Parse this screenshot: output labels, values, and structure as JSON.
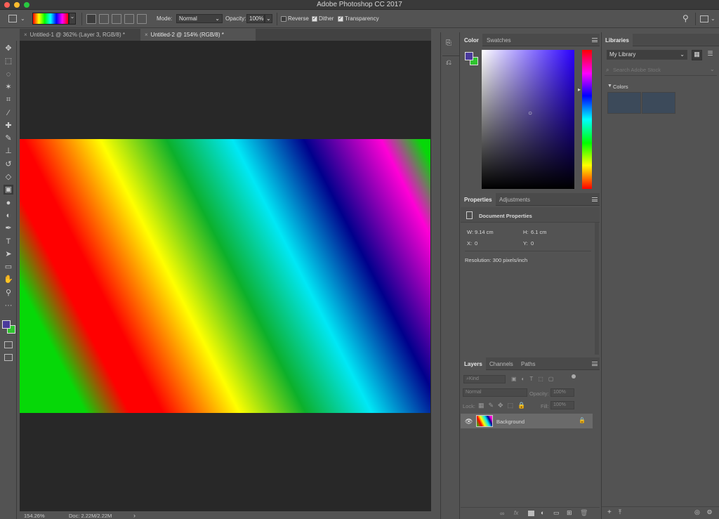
{
  "window": {
    "title": "Adobe Photoshop CC 2017"
  },
  "options_bar": {
    "mode_label": "Mode:",
    "mode_value": "Normal",
    "opacity_label": "Opacity:",
    "opacity_value": "100%",
    "reverse_label": "Reverse",
    "reverse_checked": false,
    "dither_label": "Dither",
    "dither_checked": true,
    "transparency_label": "Transparency",
    "transparency_checked": true
  },
  "tabs": [
    {
      "label": "Untitled-1 @ 362% (Layer 3, RGB/8) *",
      "close": "×",
      "active": false
    },
    {
      "label": "Untitled-2 @ 154% (RGB/8) *",
      "close": "×",
      "active": true
    }
  ],
  "tools": [
    {
      "name": "move-tool",
      "glyph": "✥"
    },
    {
      "name": "marquee-tool",
      "glyph": "⬚"
    },
    {
      "name": "lasso-tool",
      "glyph": "◌"
    },
    {
      "name": "magic-wand-tool",
      "glyph": "✶"
    },
    {
      "name": "crop-tool",
      "glyph": "⌗"
    },
    {
      "name": "eyedropper-tool",
      "glyph": "⁄"
    },
    {
      "name": "healing-brush-tool",
      "glyph": "✚"
    },
    {
      "name": "brush-tool",
      "glyph": "✎"
    },
    {
      "name": "clone-stamp-tool",
      "glyph": "⊥"
    },
    {
      "name": "history-brush-tool",
      "glyph": "↺"
    },
    {
      "name": "eraser-tool",
      "glyph": "◇"
    },
    {
      "name": "gradient-tool",
      "glyph": "▣"
    },
    {
      "name": "blur-tool",
      "glyph": "●"
    },
    {
      "name": "dodge-tool",
      "glyph": "◐"
    },
    {
      "name": "pen-tool",
      "glyph": "✒"
    },
    {
      "name": "type-tool",
      "glyph": "T"
    },
    {
      "name": "path-selection-tool",
      "glyph": "➤"
    },
    {
      "name": "rectangle-tool",
      "glyph": "▭"
    },
    {
      "name": "hand-tool",
      "glyph": "✋"
    },
    {
      "name": "zoom-tool",
      "glyph": "⚲"
    },
    {
      "name": "more-tools",
      "glyph": "···"
    }
  ],
  "colors": {
    "foreground": "#4a3a9c",
    "background": "#2fc42f"
  },
  "canvas": {
    "bg": "#282828"
  },
  "status_bar": {
    "zoom": "154.26%",
    "doc": "Doc: 2.22M/2.22M",
    "arrow": "›"
  },
  "color_panel": {
    "tabs": [
      "Color",
      "Swatches"
    ],
    "picker_marker": "○",
    "hue_marker": "▸"
  },
  "properties_panel": {
    "tabs": [
      "Properties",
      "Adjustments"
    ],
    "heading": "Document Properties",
    "w_label": "W:",
    "w_value": "9.14 cm",
    "h_label": "H:",
    "h_value": "6.1 cm",
    "x_label": "X:",
    "x_value": "0",
    "y_label": "Y:",
    "y_value": "0",
    "resolution": "Resolution: 300 pixels/inch"
  },
  "layers_panel": {
    "tabs": [
      "Layers",
      "Channels",
      "Paths"
    ],
    "kind_label": "Kind",
    "blend_mode": "Normal",
    "opacity_label": "Opacity:",
    "opacity_value": "100%",
    "lock_label": "Lock:",
    "fill_label": "Fill:",
    "fill_value": "100%",
    "layers": [
      {
        "name": "Background",
        "visible": true,
        "locked": true
      }
    ],
    "footer_icons": [
      "link-icon",
      "fx-icon",
      "mask-icon",
      "adjustment-icon",
      "folder-icon",
      "new-layer-icon",
      "trash-icon"
    ]
  },
  "libraries_panel": {
    "tab": "Libraries",
    "library_name": "My Library",
    "search_placeholder": "Search Adobe Stock",
    "section": "Colors",
    "swatches": [
      "#3c4a5a",
      "#3c4a5a"
    ]
  }
}
